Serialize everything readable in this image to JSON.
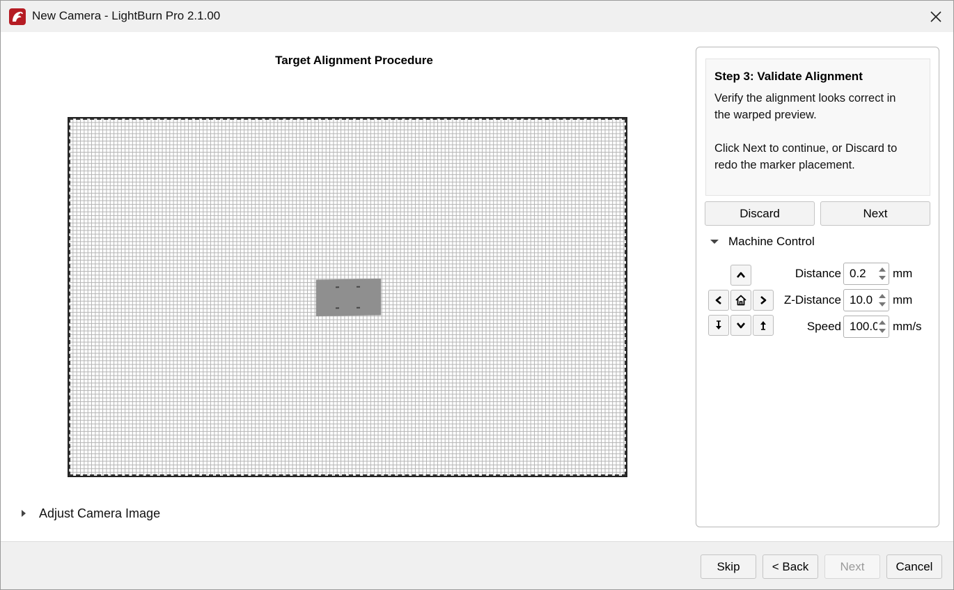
{
  "window": {
    "title": "New Camera - LightBurn Pro 2.1.00",
    "icon": "lightburn-logo-icon",
    "close_icon": "close-icon"
  },
  "main": {
    "procedure_title": "Target Alignment Procedure",
    "adjust_camera_label": "Adjust Camera Image"
  },
  "step": {
    "title": "Step 3: Validate Alignment",
    "line1": "Verify the alignment looks correct in",
    "line2": "the warped preview.",
    "line3": "Click Next to continue, or Discard to",
    "line4": "redo the marker placement.",
    "discard_label": "Discard",
    "next_label": "Next"
  },
  "machine_control": {
    "label": "Machine Control",
    "expanded": true,
    "jog_icons": [
      "arrow-up-icon",
      "arrow-left-icon",
      "home-icon",
      "arrow-right-icon",
      "move-down-icon",
      "arrow-down-icon",
      "move-up-icon"
    ],
    "distance": {
      "label": "Distance",
      "value": "0.2",
      "unit": "mm"
    },
    "z_distance": {
      "label": "Z-Distance",
      "value": "10.0",
      "unit": "mm"
    },
    "speed": {
      "label": "Speed",
      "value": "100.0",
      "unit": "mm/s"
    }
  },
  "footer": {
    "skip_label": "Skip",
    "back_label": "< Back",
    "next_label": "Next",
    "cancel_label": "Cancel"
  }
}
